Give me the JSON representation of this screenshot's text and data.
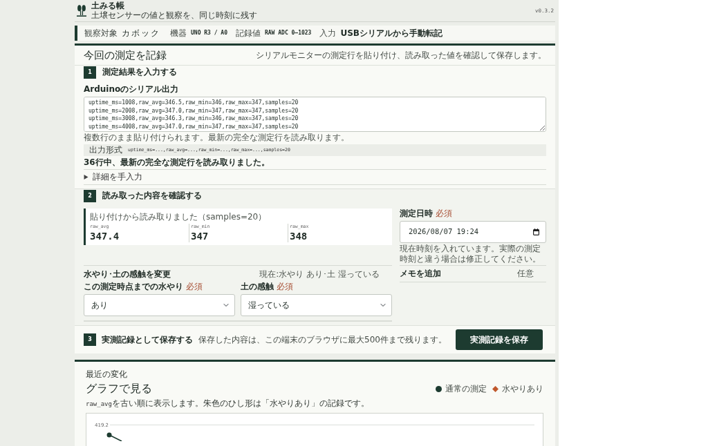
{
  "app": {
    "title": "土みる帳",
    "subtitle": "土壌センサーの値と観察を、同じ時刻に残す",
    "version": "v0.3.2"
  },
  "info_bar": [
    {
      "label": "観察対象",
      "value": "カボック",
      "kind": "name"
    },
    {
      "label": "機器",
      "value": "UNO R3 / A0",
      "kind": "code"
    },
    {
      "label": "記録値",
      "value": "RAW ADC 0–1023",
      "kind": "code"
    },
    {
      "label": "入力",
      "value": "USBシリアルから手動転記",
      "kind": "text"
    }
  ],
  "record": {
    "title": "今回の測定を記録",
    "description": "シリアルモニターの測定行を貼り付け、読み取った値を確認して保存します。",
    "step_1": {
      "number": "1",
      "title": "測定結果を入力する",
      "field_label": "Arduinoのシリアル出力",
      "serial_lines": [
        "uptime_ms=1008,raw_avg=346.5,raw_min=346,raw_max=347,samples=20",
        "uptime_ms=2008,raw_avg=347.0,raw_min=347,raw_max=347,samples=20",
        "uptime_ms=3008,raw_avg=346.3,raw_min=346,raw_max=347,samples=20",
        "uptime_ms=4008,raw_avg=347.0,raw_min=347,raw_max=347,samples=20"
      ],
      "hint": "複数行のまま貼り付けられます。最新の完全な測定行を読み取ります。",
      "format_label": "出力形式",
      "format": "uptime_ms=...,raw_avg=...,raw_min=...,raw_max=...,samples=20",
      "status": "36行中、最新の完全な測定行を読み取りました。",
      "details": {
        "label": "詳細を手入力",
        "expanded": false
      }
    },
    "step_2": {
      "number": "2",
      "title": "読み取った内容を確認する",
      "readings": {
        "caption": "貼り付けから読み取りました（samples=20）",
        "items": [
          {
            "label": "raw_avg",
            "value": "347.4"
          },
          {
            "label": "raw_min",
            "value": "347"
          },
          {
            "label": "raw_max",
            "value": "348"
          }
        ]
      },
      "datetime": {
        "label": "測定日時",
        "required": "必須",
        "value": "2026/08/07 19:24",
        "hint": "現在時刻を入れています。実際の測定時刻と違う場合は修正してください。"
      },
      "observation": {
        "title": "水やり･土の感触を変更",
        "current": "現在:水やり あり･土 湿っている",
        "fields": [
          {
            "label": "この測定時点までの水やり",
            "required": "必須",
            "value": "あり"
          },
          {
            "label": "土の感触",
            "required": "必須",
            "value": "湿っている"
          }
        ]
      },
      "memo": {
        "title": "メモを追加",
        "optional": "任意"
      }
    },
    "step_3": {
      "number": "3",
      "title": "実測記録として保存する",
      "note": "保存した内容は、この端末のブラウザに最大500件まで残ります。",
      "button": "実測記録を保存"
    }
  },
  "chart_panel": {
    "eyebrow": "最近の変化",
    "title": "グラフで見る",
    "legend": [
      {
        "label": "通常の測定",
        "kind": "dot",
        "color": "#1d3b30"
      },
      {
        "label": "水やりあり",
        "kind": "diamond",
        "color": "#c0582c"
      }
    ],
    "description": [
      {
        "kind": "code",
        "text": "raw_avg"
      },
      {
        "kind": "text",
        "text": "を古い順に表示します。朱色のひし形は「水やりあり」の記録です。"
      }
    ],
    "chart": {
      "tick_label": "419.2"
    }
  }
}
